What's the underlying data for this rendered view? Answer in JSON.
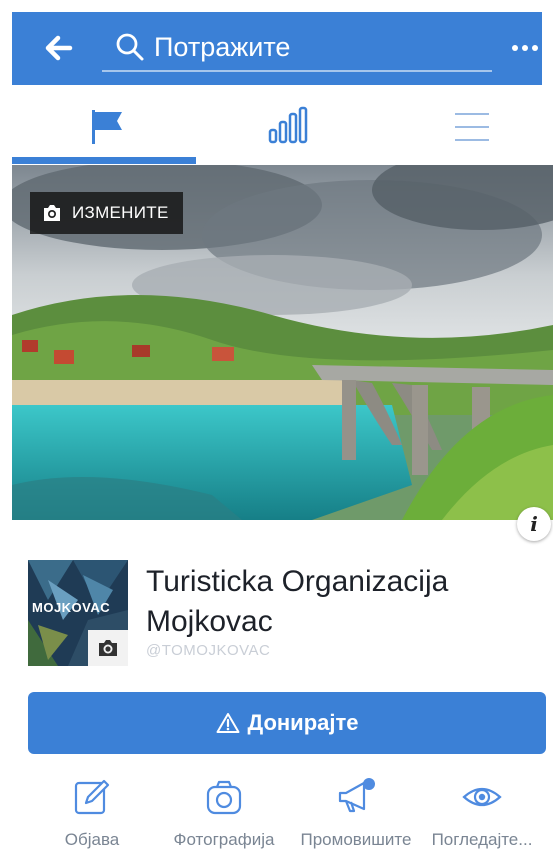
{
  "topbar": {
    "search_placeholder": "Потражите",
    "back_icon": "arrow-left-icon",
    "search_icon": "magnifier-icon",
    "more_icon": "more-dots-icon",
    "accent_color": "#3b80d6"
  },
  "tabs": [
    {
      "icon": "flag-icon",
      "active": true
    },
    {
      "icon": "insights-bars-icon",
      "active": false
    },
    {
      "icon": "menu-lines-icon",
      "active": false
    }
  ],
  "cover": {
    "edit_label": "ИЗМЕНИТЕ",
    "info_label": "i"
  },
  "profile": {
    "name": "Turisticka Organizacija Mojkovac",
    "handle": "@TOMOJKOVAC",
    "avatar_text": "MOJKOVAC"
  },
  "donate": {
    "label": "Донирајте",
    "icon": "warning-triangle-icon"
  },
  "actions": [
    {
      "label": "Објава",
      "icon": "pencil-icon"
    },
    {
      "label": "Фотографија",
      "icon": "camera-icon"
    },
    {
      "label": "Промовишите",
      "icon": "megaphone-icon"
    },
    {
      "label": "Погледајте...",
      "icon": "eye-icon"
    }
  ]
}
